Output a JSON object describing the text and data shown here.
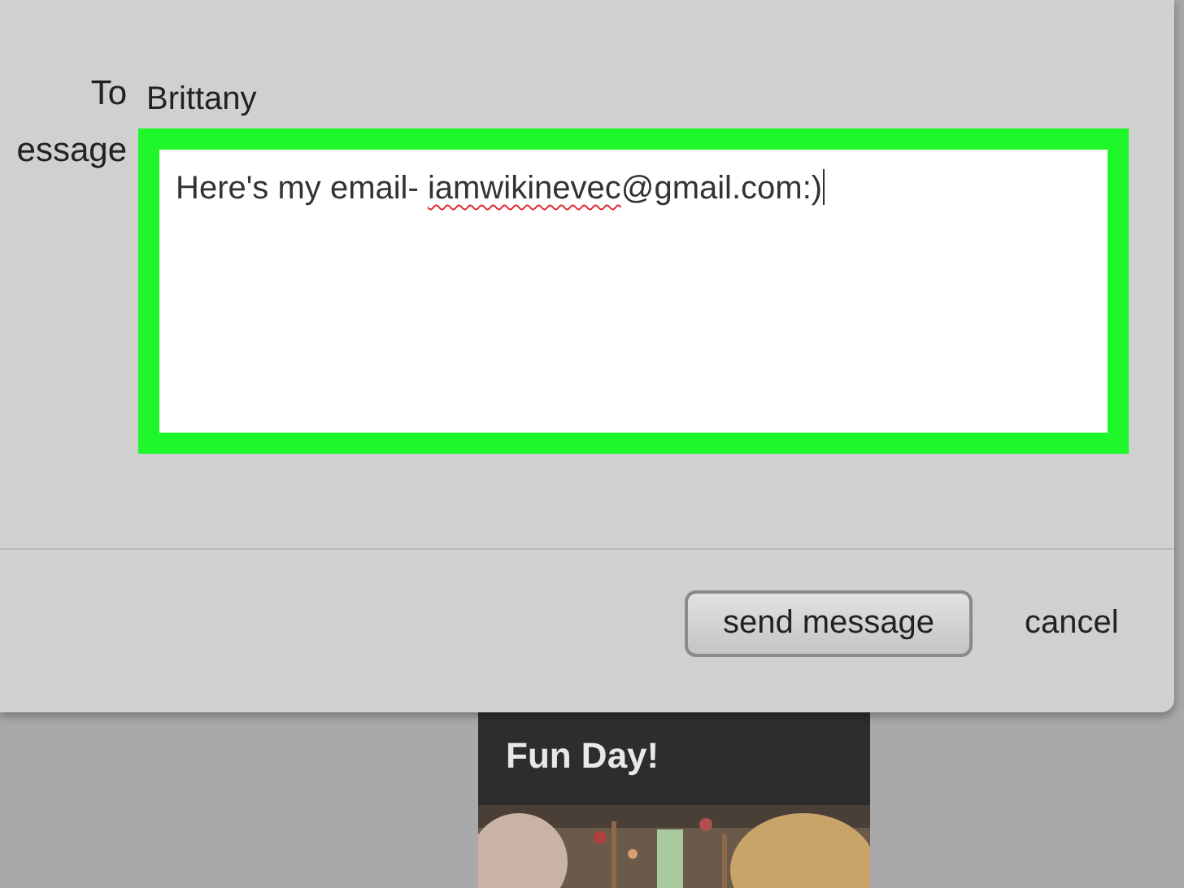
{
  "form": {
    "to_label": "To",
    "to_value": "Brittany",
    "message_label": "essage",
    "message_parts": [
      {
        "text": "Here's my email- ",
        "misspelled": false
      },
      {
        "text": "iamwikinevec",
        "misspelled": true
      },
      {
        "text": "@gmail.com:)",
        "misspelled": false
      }
    ],
    "focused": true
  },
  "buttons": {
    "send": "send message",
    "cancel": "cancel"
  },
  "card": {
    "title": "Fun Day!",
    "kind": "picture"
  }
}
